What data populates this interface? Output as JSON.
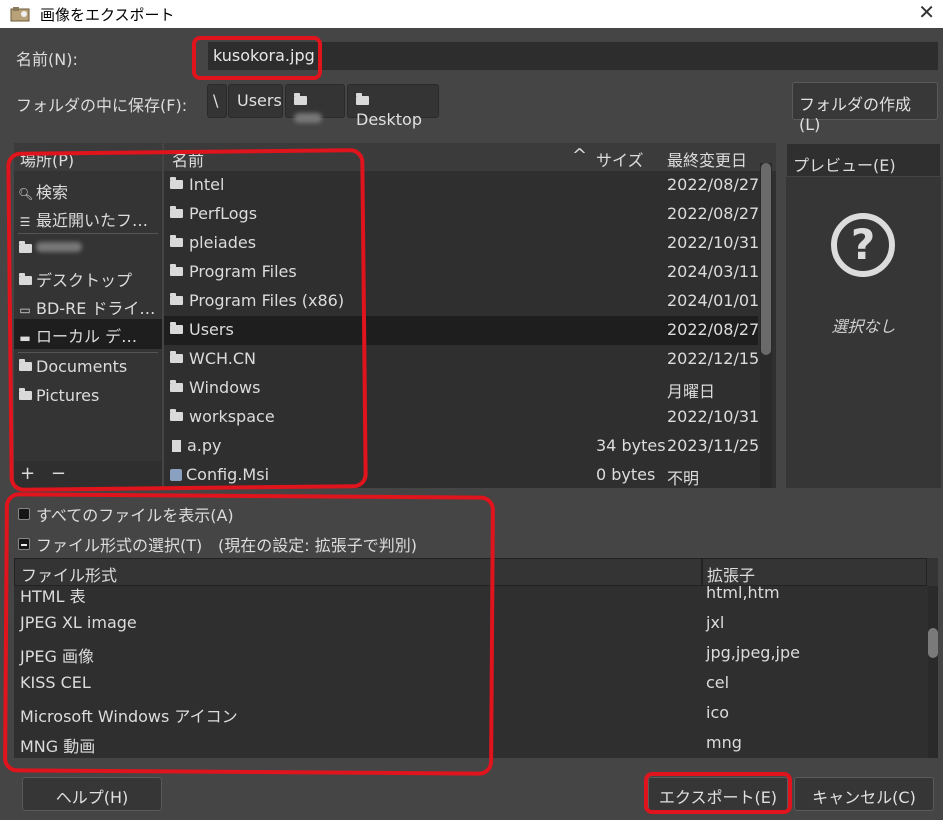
{
  "window": {
    "title": "画像をエクスポート",
    "close_glyph": "✕"
  },
  "name_row": {
    "label": "名前(N):",
    "value": "kusokora.jpg"
  },
  "folder_row": {
    "label": "フォルダの中に保存(F):",
    "crumbs": [
      "\\",
      "Users",
      "Desktop"
    ],
    "create_folder": "フォルダの作成(L)"
  },
  "places": {
    "header": "場所(P)",
    "items": [
      {
        "icon": "search-icon",
        "label": "検索"
      },
      {
        "icon": "recent-icon",
        "label": "最近開いたフ…"
      },
      {
        "icon": "folder-icon",
        "label": ""
      },
      {
        "icon": "folder-icon",
        "label": "デスクトップ"
      },
      {
        "icon": "drive-icon",
        "label": "BD-RE ドライ…"
      },
      {
        "icon": "drive-icon",
        "label": "ローカル デ…"
      },
      {
        "icon": "folder-icon",
        "label": "Documents"
      },
      {
        "icon": "folder-icon",
        "label": "Pictures"
      }
    ],
    "add": "+",
    "remove": "−"
  },
  "files": {
    "columns": {
      "name": "名前",
      "size": "サイズ",
      "modified": "最終変更日",
      "sort_glyph": "^"
    },
    "rows": [
      {
        "type": "folder",
        "name": "Intel",
        "size": "",
        "date": "2022/08/27"
      },
      {
        "type": "folder",
        "name": "PerfLogs",
        "size": "",
        "date": "2022/08/27"
      },
      {
        "type": "folder",
        "name": "pleiades",
        "size": "",
        "date": "2022/10/31"
      },
      {
        "type": "folder",
        "name": "Program Files",
        "size": "",
        "date": "2024/03/11"
      },
      {
        "type": "folder",
        "name": "Program Files (x86)",
        "size": "",
        "date": "2024/01/01"
      },
      {
        "type": "folder",
        "name": "Users",
        "size": "",
        "date": "2022/08/27"
      },
      {
        "type": "folder",
        "name": "WCH.CN",
        "size": "",
        "date": "2022/12/15"
      },
      {
        "type": "folder",
        "name": "Windows",
        "size": "",
        "date": "月曜日"
      },
      {
        "type": "folder",
        "name": "workspace",
        "size": "",
        "date": "2022/10/31"
      },
      {
        "type": "file",
        "name": "a.py",
        "size": "34 bytes",
        "date": "2023/11/25"
      },
      {
        "type": "msi",
        "name": "Config.Msi",
        "size": "0 bytes",
        "date": "不明"
      }
    ]
  },
  "preview": {
    "header": "プレビュー(E)",
    "icon": "question-icon",
    "glyph": "?",
    "empty_text": "選択なし"
  },
  "options": {
    "show_all_files": "すべてのファイルを表示(A)",
    "file_type_select": "ファイル形式の選択(T)",
    "file_type_current": "(現在の設定: 拡張子で判別)"
  },
  "file_types": {
    "columns": {
      "type": "ファイル形式",
      "ext": "拡張子"
    },
    "rows": [
      {
        "type": "HTML 表",
        "ext": "html,htm"
      },
      {
        "type": "JPEG XL image",
        "ext": "jxl"
      },
      {
        "type": "JPEG 画像",
        "ext": "jpg,jpeg,jpe"
      },
      {
        "type": "KISS CEL",
        "ext": "cel"
      },
      {
        "type": "Microsoft Windows アイコン",
        "ext": "ico"
      },
      {
        "type": "MNG 動画",
        "ext": "mng"
      }
    ]
  },
  "buttons": {
    "help": "ヘルプ(H)",
    "export": "エクスポート(E)",
    "cancel": "キャンセル(C)"
  },
  "colors": {
    "annotation": "#e0141c",
    "background": "#454545",
    "selected_row": "#1e1e1e"
  }
}
